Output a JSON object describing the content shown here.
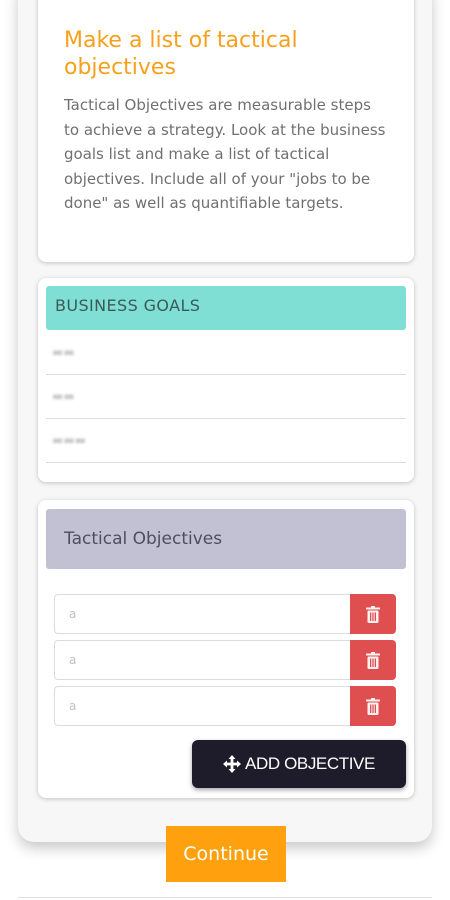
{
  "intro": {
    "title": "Make a list of tactical objectives",
    "description": "Tactical Objectives are measurable steps to achieve a strategy. Look at the business goals list and make a list of tactical objectives. Include all of your \"jobs to be done\" as well as quantifiable targets."
  },
  "goals": {
    "title": "BUSINESS GOALS",
    "items": [
      "▬▬",
      "▬▬",
      "▬▬▬"
    ]
  },
  "objectives": {
    "title": "Tactical Objectives",
    "rows": [
      {
        "value": "",
        "placeholder": "a"
      },
      {
        "value": "",
        "placeholder": "a"
      },
      {
        "value": "",
        "placeholder": "a"
      }
    ],
    "delete_icon": "trash-icon",
    "add_label": "ADD OBJECTIVE",
    "add_icon": "move-arrows-icon"
  },
  "continue_label": "Continue",
  "colors": {
    "accent_orange": "#f7a01b",
    "goals_header": "#7fdfd4",
    "objectives_header": "#c2c1d4",
    "delete_red": "#e04f4f",
    "add_button": "#1e1c2a",
    "continue_button": "#ffa10f"
  }
}
